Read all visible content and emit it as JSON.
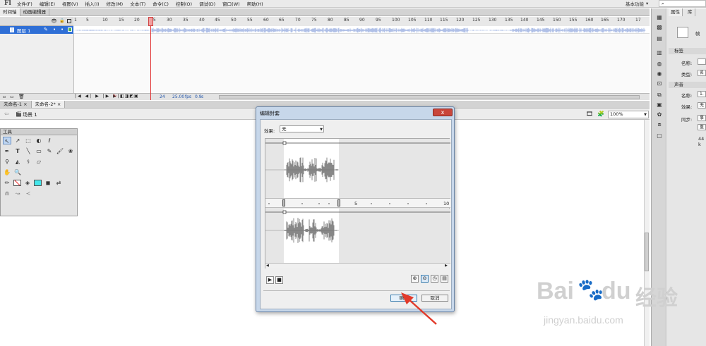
{
  "app": {
    "logo": "Fl",
    "workspace": "基本功能",
    "workspace_arrow": "▾",
    "search_icon_char": "⌕"
  },
  "menu": [
    "文件(F)",
    "编辑(E)",
    "视图(V)",
    "插入(I)",
    "修改(M)",
    "文本(T)",
    "命令(C)",
    "控制(O)",
    "调试(D)",
    "窗口(W)",
    "帮助(H)"
  ],
  "timeline": {
    "tabs": [
      "时间轴",
      "动画编辑器"
    ],
    "ruler": [
      "1",
      "5",
      "10",
      "15",
      "20",
      "25",
      "30",
      "35",
      "40",
      "45",
      "50",
      "55",
      "60",
      "65",
      "70",
      "75",
      "80",
      "85",
      "90",
      "95",
      "100",
      "105",
      "110",
      "115",
      "120",
      "125",
      "130",
      "135",
      "140",
      "145",
      "150",
      "155",
      "160",
      "165",
      "170",
      "17"
    ],
    "layer": "图层 1",
    "current_frame": "24",
    "fps": "25.00",
    "fps_unit": "fps",
    "elapsed": "0.9",
    "elapsed_unit": "s"
  },
  "doc_tabs": [
    "未命名-1",
    "未命名-2*"
  ],
  "scene": "场景 1",
  "zoom": "100%",
  "tools": {
    "title": "工具"
  },
  "properties": {
    "tabs": [
      "属性",
      "库"
    ],
    "frame_label": "帧",
    "label_section": "标签",
    "name_label": "名称:",
    "type_label": "类型:",
    "type_value": "名",
    "sound_section": "声音",
    "sound_name_label": "名称:",
    "sound_name_value": "1.",
    "effect_label": "效果:",
    "effect_value": "无",
    "sync_label": "同步:",
    "sync_value": "事",
    "repeat_value": "重",
    "info": "44 k"
  },
  "dialog": {
    "title": "编辑封套",
    "close_char": "x",
    "effect_label": "效果:",
    "effect_value": "无",
    "ruler": [
      "5",
      "10"
    ],
    "ok": "确定",
    "cancel": "取消"
  },
  "watermark": {
    "brand": "Bai",
    "brand2": "du",
    "cn": "经验",
    "url": "jingyan.baidu.com"
  },
  "colors": {
    "selected_layer": "#2f6fd6",
    "playhead": "#e03030",
    "waveform": "#6a6a6a",
    "timeline_wave": "#8ea6dd",
    "dialog_frame": "#c7d7ea"
  }
}
